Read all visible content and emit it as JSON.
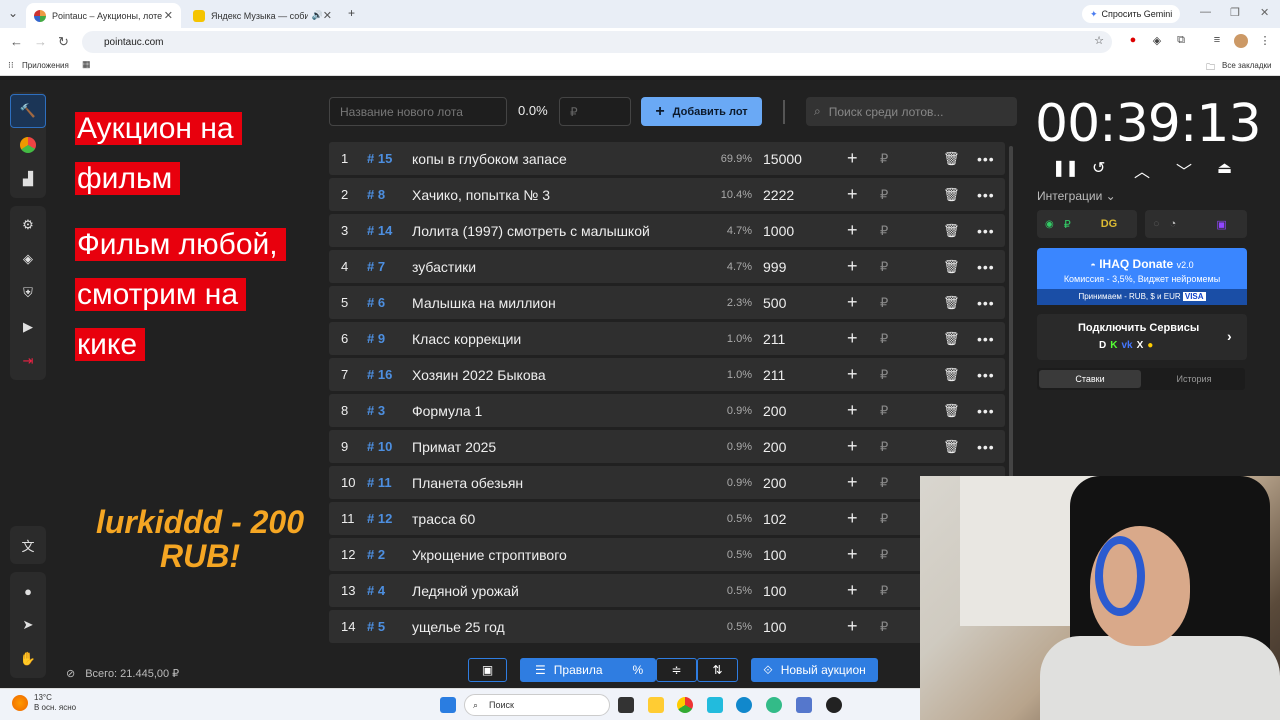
{
  "browser": {
    "tabs": [
      {
        "title": "Pointauc – Аукционы, лотереи",
        "active": true
      },
      {
        "title": "Яндекс Музыка — собирае",
        "active": false
      }
    ],
    "gemini": "Спросить Gemini",
    "url": "pointauc.com",
    "bookmarks": {
      "apps": "Приложения",
      "all": "Все закладки"
    }
  },
  "overlay": {
    "line1": "Аукцион на",
    "line2": "фильм",
    "line3": "Фильм любой,",
    "line4": "смотрим на",
    "line5": "кике",
    "donation": "lurkiddd - 200 RUB!"
  },
  "toolbar": {
    "lot_placeholder": "Название нового лота",
    "percent": "0.0%",
    "rub_placeholder": "₽",
    "add_lot": "Добавить лот",
    "search_placeholder": "Поиск среди лотов..."
  },
  "lots": [
    {
      "n": "1",
      "id": "15",
      "name": "копы в глубоком запасе",
      "pct": "69.9%",
      "amount": "15000"
    },
    {
      "n": "2",
      "id": "8",
      "name": "Хачико, попытка № 3",
      "pct": "10.4%",
      "amount": "2222"
    },
    {
      "n": "3",
      "id": "14",
      "name": "Лолита (1997) смотреть с малышкой",
      "pct": "4.7%",
      "amount": "1000"
    },
    {
      "n": "4",
      "id": "7",
      "name": " зубастики",
      "pct": "4.7%",
      "amount": "999"
    },
    {
      "n": "5",
      "id": "6",
      "name": "Малышка на миллион",
      "pct": "2.3%",
      "amount": "500"
    },
    {
      "n": "6",
      "id": "9",
      "name": "Класс коррекции",
      "pct": "1.0%",
      "amount": "211"
    },
    {
      "n": "7",
      "id": "16",
      "name": "Хозяин 2022 Быкова",
      "pct": "1.0%",
      "amount": "211"
    },
    {
      "n": "8",
      "id": "3",
      "name": "Формула 1",
      "pct": "0.9%",
      "amount": "200"
    },
    {
      "n": "9",
      "id": "10",
      "name": "Примат 2025",
      "pct": "0.9%",
      "amount": "200"
    },
    {
      "n": "10",
      "id": "11",
      "name": "Планета обезьян",
      "pct": "0.9%",
      "amount": "200"
    },
    {
      "n": "11",
      "id": "12",
      "name": "трасса 60",
      "pct": "0.5%",
      "amount": "102"
    },
    {
      "n": "12",
      "id": "2",
      "name": "Укрощение строптивого",
      "pct": "0.5%",
      "amount": "100"
    },
    {
      "n": "13",
      "id": "4",
      "name": "Ледяной урожай",
      "pct": "0.5%",
      "amount": "100"
    },
    {
      "n": "14",
      "id": "5",
      "name": "ущелье 25 год",
      "pct": "0.5%",
      "amount": "100"
    }
  ],
  "bottom": {
    "total": "Всего: 21.445,00 ₽",
    "rules": "Правила",
    "new_auction": "Новый аукцион"
  },
  "timer": {
    "value": "00:39:13"
  },
  "panel": {
    "integrations": "Интеграции",
    "donate_title": "IHAQ Donate",
    "donate_version": "v2.0",
    "donate_line": "Комиссия - 3,5%, Виджет нейромемы",
    "donate_foot": "Принимаем - RUB, $ и EUR",
    "services": "Подключить Сервисы",
    "tab_bets": "Ставки",
    "tab_history": "История"
  },
  "taskbar": {
    "temp": "13°C",
    "weather": "В осн. ясно",
    "search": "Поиск"
  },
  "colors": {
    "accent": "#2f7de1",
    "overlay_red": "#e8000d",
    "donation": "#f5a623",
    "lot_id": "#4d8fe0"
  }
}
